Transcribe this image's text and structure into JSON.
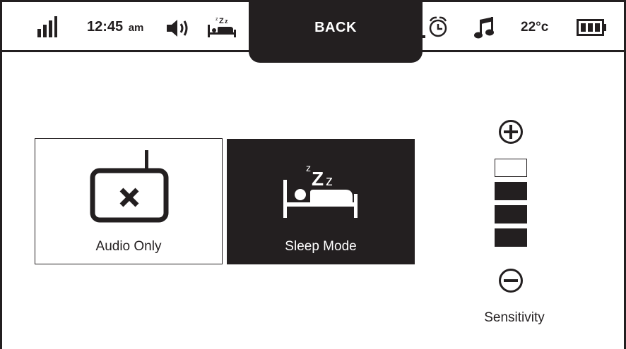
{
  "status_bar": {
    "time": "12:45",
    "ampm": "am",
    "temperature": "22°c",
    "back_label": "BACK",
    "icons": [
      "signal-icon",
      "speaker-icon",
      "sleep-icon",
      "alarm-icon",
      "music-icon",
      "battery-icon"
    ]
  },
  "modes": [
    {
      "label": "Audio Only",
      "icon": "audio-only-icon",
      "selected": false
    },
    {
      "label": "Sleep Mode",
      "icon": "sleep-mode-icon",
      "selected": true
    }
  ],
  "sensitivity": {
    "label": "Sensitivity",
    "levels_total": 4,
    "levels_filled": 3
  },
  "colors": {
    "foreground": "#231f20",
    "background": "#ffffff"
  }
}
